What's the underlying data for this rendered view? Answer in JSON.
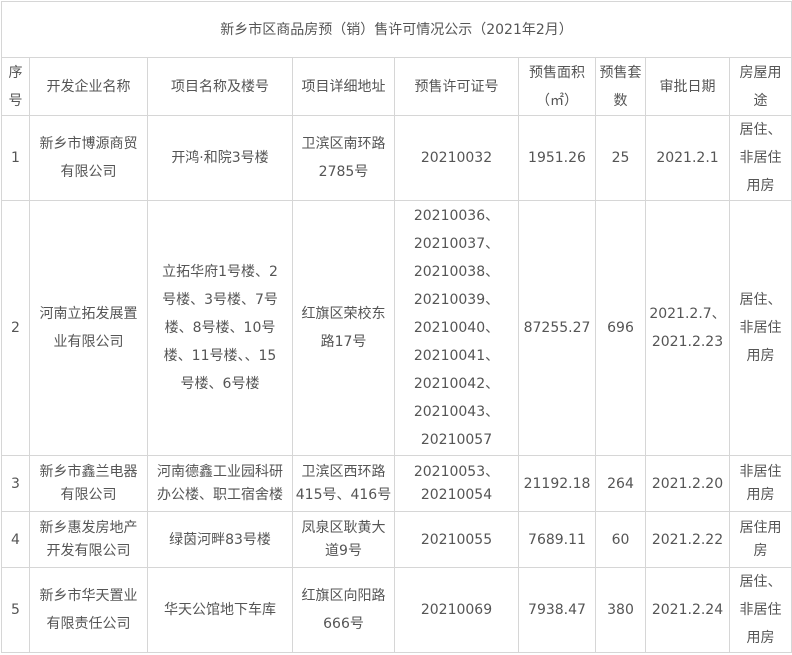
{
  "title": "新乡市区商品房预（销）售许可情况公示（2021年2月）",
  "headers": [
    [
      "序",
      "号"
    ],
    [
      "开发企业名称"
    ],
    [
      "项目名称及楼号"
    ],
    [
      "项目详细地址"
    ],
    [
      "预售许可证号"
    ],
    [
      "预售面积",
      "（㎡）"
    ],
    [
      "预售套",
      "数"
    ],
    [
      "审批日期"
    ],
    [
      "房屋用",
      "途"
    ]
  ],
  "rows": [
    {
      "no": "1",
      "company": [
        "新乡市博源商贸",
        "有限公司"
      ],
      "project": [
        "开鸿·和院3号楼"
      ],
      "address": [
        "卫滨区南环路",
        "2785号"
      ],
      "permits": [
        "20210032"
      ],
      "area": "1951.26",
      "units": "25",
      "date": [
        "2021.2.1"
      ],
      "use": [
        "居住、",
        "非居住",
        "用房"
      ]
    },
    {
      "no": "2",
      "company": [
        "河南立拓发展置",
        "业有限公司"
      ],
      "project": [
        "立拓华府1号楼、2",
        "号楼、3号楼、7号",
        "楼、8号楼、10号",
        "楼、11号楼、、15",
        "号楼、6号楼"
      ],
      "address": [
        "红旗区荣校东",
        "路17号"
      ],
      "permits": [
        "20210036、",
        "20210037、",
        "20210038、",
        "20210039、",
        "20210040、",
        "20210041、",
        "20210042、",
        "20210043、",
        "20210057"
      ],
      "area": "87255.27",
      "units": "696",
      "date": [
        "2021.2.7、",
        "2021.2.23"
      ],
      "use": [
        "居住、",
        "非居住",
        "用房"
      ]
    },
    {
      "no": "3",
      "company": [
        "新乡市鑫兰电器",
        "有限公司"
      ],
      "project": [
        "河南德鑫工业园科研",
        "办公楼、职工宿舍楼"
      ],
      "address": [
        "卫滨区西环路",
        "415号、416号"
      ],
      "permits": [
        "20210053、",
        "20210054"
      ],
      "area": "21192.18",
      "units": "264",
      "date": [
        "2021.2.20"
      ],
      "use": [
        "非居住",
        "用房"
      ]
    },
    {
      "no": "4",
      "company": [
        "新乡惠发房地产",
        "开发有限公司"
      ],
      "project": [
        "绿茵河畔83号楼"
      ],
      "address": [
        "凤泉区耿黄大",
        "道9号"
      ],
      "permits": [
        "20210055"
      ],
      "area": "7689.11",
      "units": "60",
      "date": [
        "2021.2.22"
      ],
      "use": [
        "居住用",
        "房"
      ]
    },
    {
      "no": "5",
      "company": [
        "新乡市华天置业",
        "有限责任公司"
      ],
      "project": [
        "华天公馆地下车库"
      ],
      "address": [
        "红旗区向阳路",
        "666号"
      ],
      "permits": [
        "20210069"
      ],
      "area": "7938.47",
      "units": "380",
      "date": [
        "2021.2.24"
      ],
      "use": [
        "居住、",
        "非居住",
        "用房"
      ]
    }
  ]
}
